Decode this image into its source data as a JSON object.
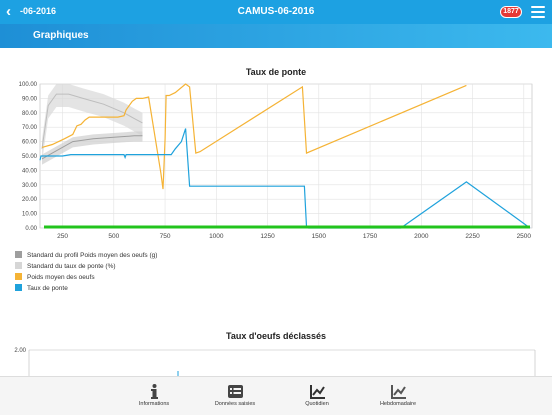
{
  "header": {
    "back_icon": "chevron-left-icon",
    "subtitle": "-06-2016",
    "title": "CAMUS-06-2016",
    "badge": "1877",
    "menu_icon": "hamburger-menu-icon",
    "section": "Graphiques"
  },
  "chart1": {
    "title": "Taux de ponte",
    "y_ticks": [
      "0.00",
      "10.00",
      "20.00",
      "30.00",
      "40.00",
      "50.00",
      "60.00",
      "70.00",
      "80.00",
      "90.00",
      "100.00"
    ],
    "x_ticks": [
      "250",
      "500",
      "750",
      "1000",
      "1250",
      "1500",
      "1750",
      "2000",
      "2250",
      "2500"
    ]
  },
  "chart2": {
    "title": "Taux d'oeufs déclassés",
    "y_ticks": [
      "2.00"
    ]
  },
  "legend": [
    {
      "label": "Standard du profil Poids moyen des oeufs (g)",
      "color": "#9e9e9e"
    },
    {
      "label": "Standard du taux de ponte (%)",
      "color": "#d6d6d6"
    },
    {
      "label": "Poids moyen des oeufs",
      "color": "#f5b335"
    },
    {
      "label": "Taux de ponte",
      "color": "#1fa2dc"
    }
  ],
  "chart_data": [
    {
      "type": "line",
      "title": "Taux de ponte",
      "xlim": [
        140,
        2540
      ],
      "ylim": [
        0,
        100
      ],
      "series": [
        {
          "name": "Taux de ponte",
          "color": "#1fa2dc",
          "points": [
            [
              140,
              47
            ],
            [
              145,
              50
            ],
            [
              250,
              50
            ],
            [
              290,
              51
            ],
            [
              330,
              51
            ],
            [
              400,
              51
            ],
            [
              450,
              51
            ],
            [
              550,
              51
            ],
            [
              555,
              49
            ],
            [
              560,
              51
            ],
            [
              600,
              51
            ],
            [
              700,
              51
            ],
            [
              750,
              51
            ],
            [
              780,
              51
            ],
            [
              800,
              55
            ],
            [
              830,
              60
            ],
            [
              850,
              69
            ],
            [
              870,
              29
            ],
            [
              900,
              29
            ],
            [
              1000,
              29
            ],
            [
              1200,
              29
            ],
            [
              1400,
              29
            ],
            [
              1430,
              29
            ],
            [
              1440,
              1
            ],
            [
              1450,
              0
            ],
            [
              1900,
              0
            ],
            [
              2220,
              32
            ],
            [
              2530,
              0
            ]
          ]
        },
        {
          "name": "Poids moyen des oeufs",
          "color": "#f5b335",
          "points": [
            [
              150,
              56
            ],
            [
              200,
              58
            ],
            [
              260,
              62
            ],
            [
              300,
              65
            ],
            [
              320,
              71
            ],
            [
              340,
              72
            ],
            [
              360,
              75
            ],
            [
              380,
              77
            ],
            [
              430,
              77
            ],
            [
              480,
              77
            ],
            [
              520,
              77
            ],
            [
              550,
              78
            ],
            [
              560,
              82
            ],
            [
              590,
              88
            ],
            [
              610,
              90
            ],
            [
              640,
              90
            ],
            [
              670,
              91
            ],
            [
              730,
              38
            ],
            [
              740,
              27
            ],
            [
              750,
              62
            ],
            [
              755,
              92
            ],
            [
              770,
              92
            ],
            [
              800,
              94
            ],
            [
              850,
              100
            ],
            [
              870,
              98
            ],
            [
              900,
              52
            ],
            [
              920,
              53
            ],
            [
              1420,
              98
            ],
            [
              1440,
              52
            ],
            [
              2220,
              99
            ]
          ]
        },
        {
          "name": "Standard du profil Poids moyen des oeufs (g)",
          "color": "#9e9e9e",
          "points": [
            [
              150,
              48
            ],
            [
              200,
              52
            ],
            [
              300,
              60
            ],
            [
              400,
              62
            ],
            [
              500,
              63
            ],
            [
              600,
              64
            ],
            [
              640,
              64
            ]
          ]
        },
        {
          "name": "Standard du taux de ponte (%)",
          "color": "#bdbdbd",
          "points": [
            [
              150,
              55
            ],
            [
              180,
              85
            ],
            [
              220,
              93
            ],
            [
              280,
              93
            ],
            [
              350,
              90
            ],
            [
              450,
              86
            ],
            [
              550,
              80
            ],
            [
              600,
              76
            ],
            [
              640,
              73
            ]
          ]
        }
      ]
    },
    {
      "type": "line",
      "title": "Taux d'oeufs déclassés",
      "ylim": [
        0,
        2
      ]
    }
  ],
  "nav": [
    {
      "label": "Informations",
      "icon": "info-icon"
    },
    {
      "label": "Données saisies",
      "icon": "list-icon"
    },
    {
      "label": "Quotidien",
      "icon": "line-chart-icon"
    },
    {
      "label": "Hebdomadaire",
      "icon": "line-chart-icon"
    }
  ]
}
